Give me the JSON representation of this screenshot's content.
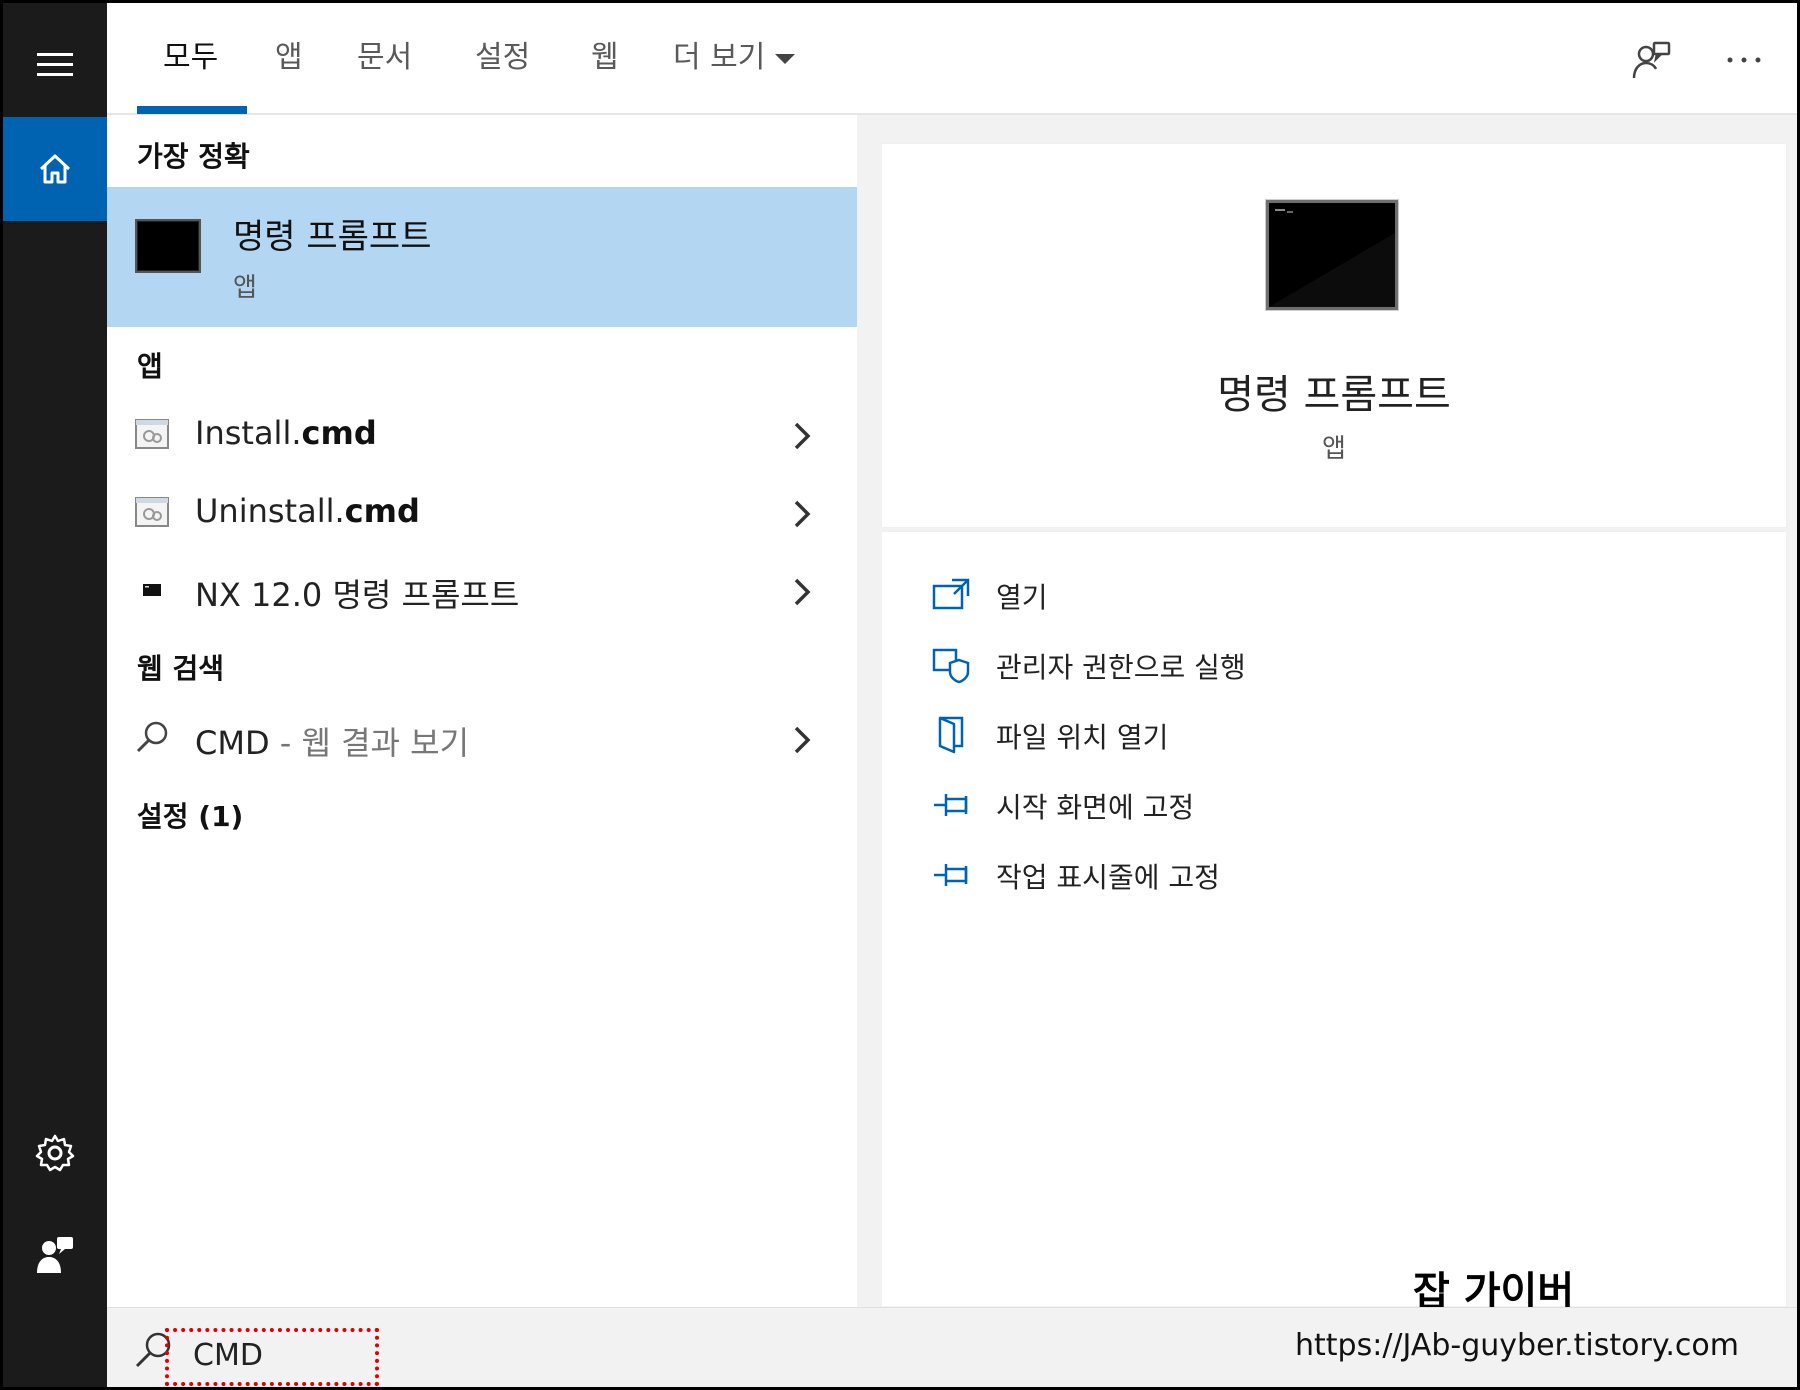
{
  "tabs": {
    "all": "모두",
    "apps": "앱",
    "documents": "문서",
    "settings": "설정",
    "web": "웹",
    "more": "더 보기"
  },
  "left": {
    "best_match_heading": "가장 정확",
    "best_match": {
      "title": "명령 프롬프트",
      "subtitle": "앱"
    },
    "apps_heading": "앱",
    "apps": [
      {
        "name_plain": "Install.",
        "name_bold": "cmd"
      },
      {
        "name_plain": "Uninstall.",
        "name_bold": "cmd"
      },
      {
        "name_plain": "NX 12.0 명령 프롬프트",
        "name_bold": ""
      }
    ],
    "web_heading": "웹 검색",
    "web_result": {
      "query": "CMD",
      "suffix": " - 웹 결과 보기"
    },
    "settings_heading": "설정 (1)"
  },
  "detail": {
    "title": "명령 프롬프트",
    "subtitle": "앱",
    "actions": [
      {
        "label": "열기",
        "icon": "open-icon"
      },
      {
        "label": "관리자 권한으로 실행",
        "icon": "admin-shield-icon"
      },
      {
        "label": "파일 위치 열기",
        "icon": "file-location-icon"
      },
      {
        "label": "시작 화면에 고정",
        "icon": "pin-icon"
      },
      {
        "label": "작업 표시줄에 고정",
        "icon": "pin-icon"
      }
    ]
  },
  "search": {
    "value": "CMD"
  },
  "watermark": {
    "name": "잡 가이버",
    "url": "https://JAb-guyber.tistory.com"
  },
  "colors": {
    "accent": "#0063b1",
    "selected": "#b3d7f2",
    "rail": "#1b1b1b",
    "annotation": "#e00000"
  }
}
